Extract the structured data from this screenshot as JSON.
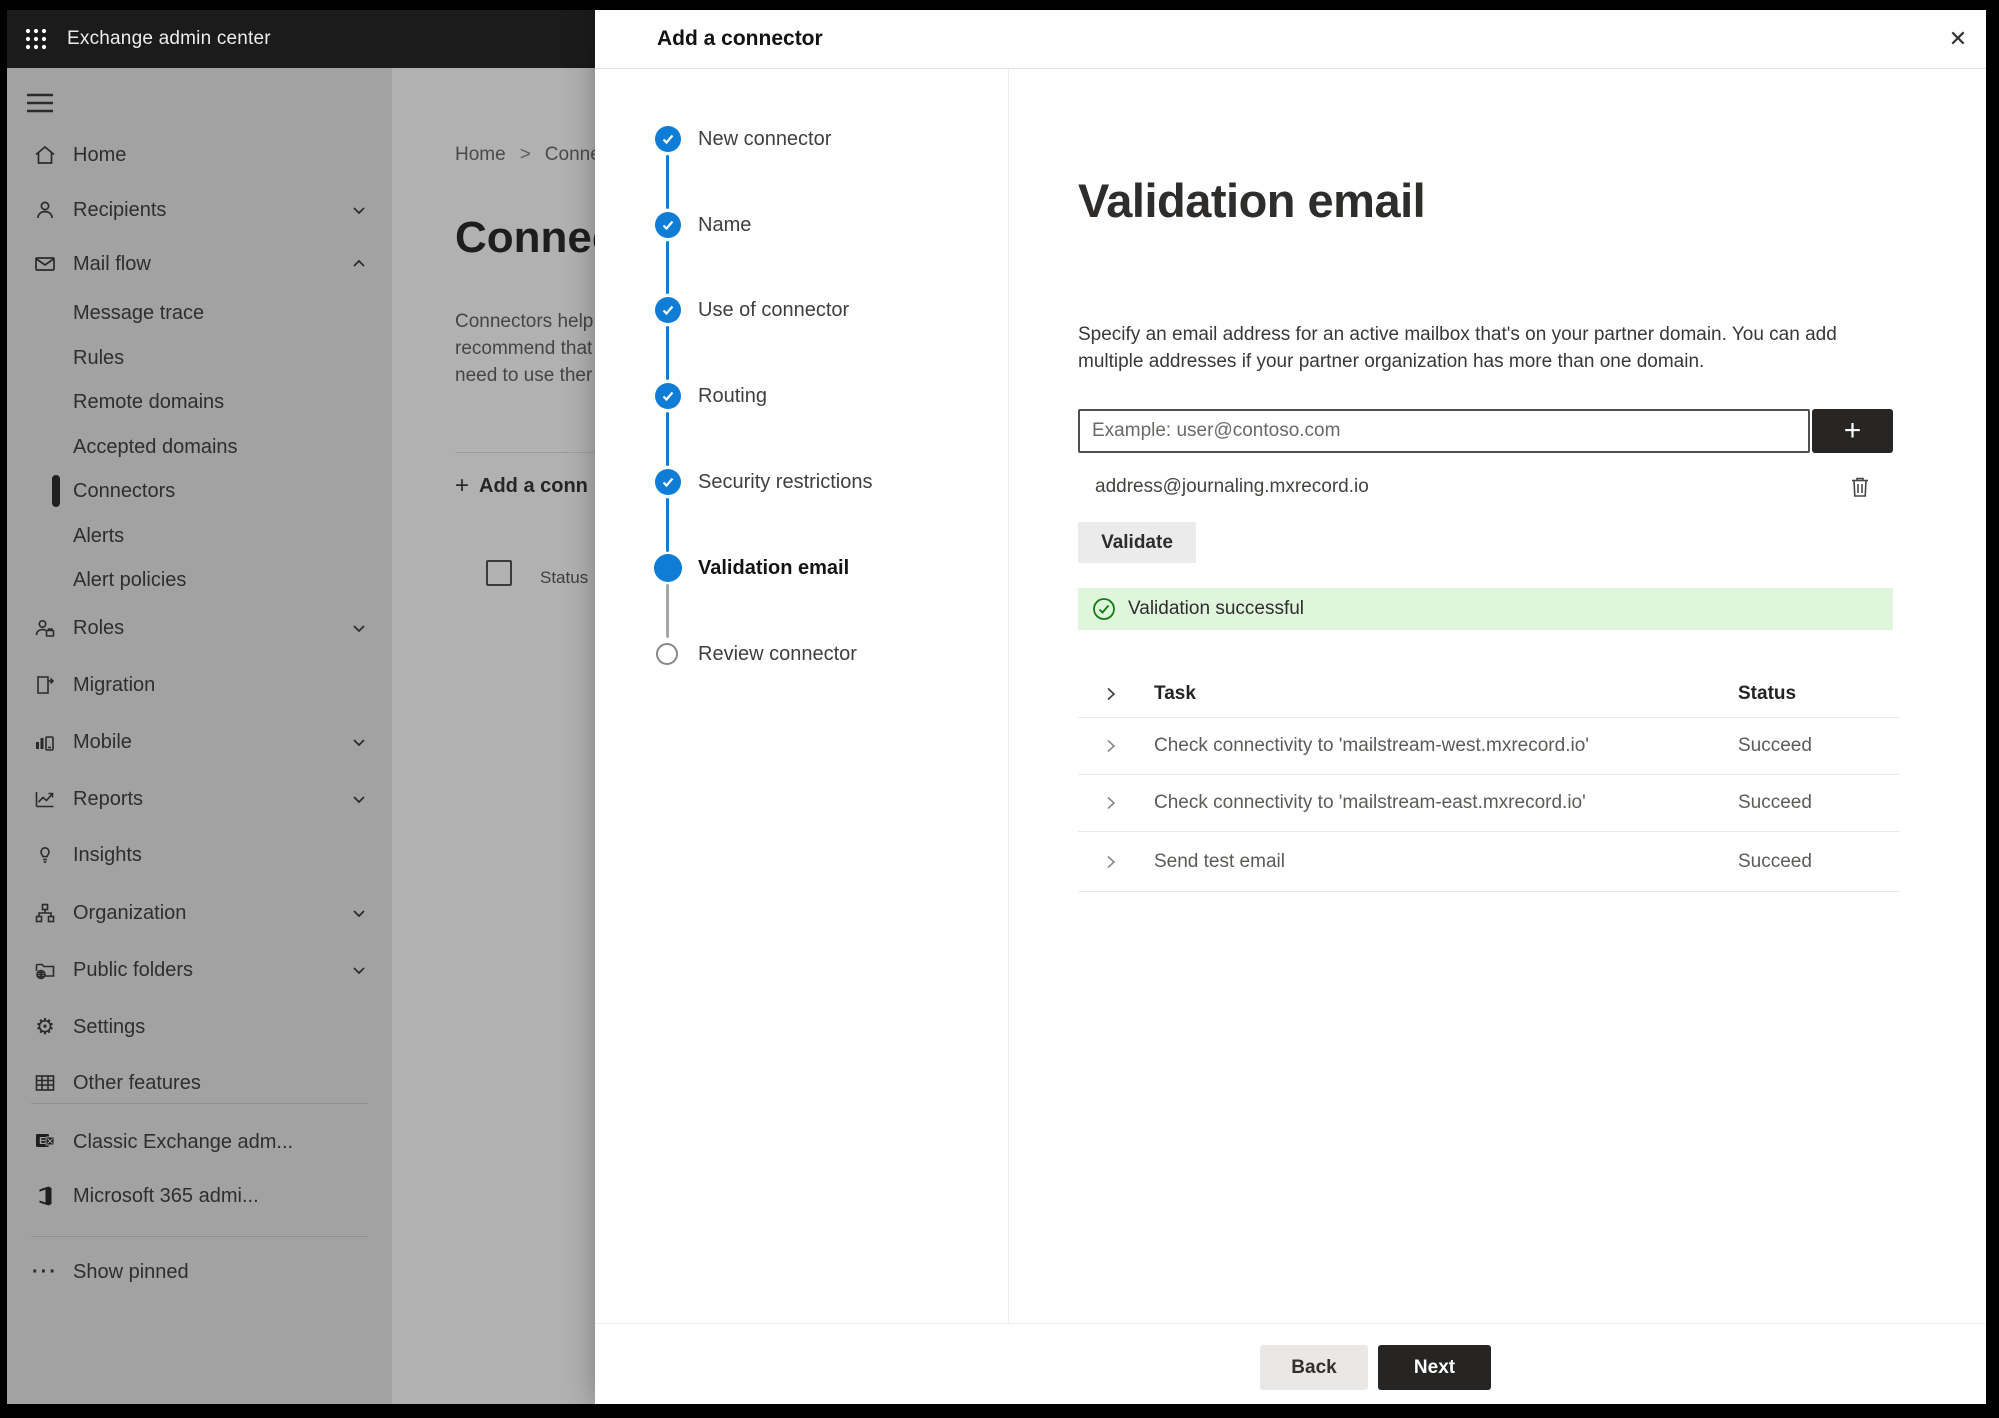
{
  "app": {
    "title": "Exchange admin center"
  },
  "colors": {
    "accent_blue": "#0f7cd6",
    "success_green": "#107c10",
    "banner_green_bg": "#dff6dd",
    "topbar_black": "#1b1b1b",
    "primary_button_dark": "#262524"
  },
  "sidebar": {
    "items": [
      {
        "label": "Home"
      },
      {
        "label": "Recipients"
      },
      {
        "label": "Mail flow"
      },
      {
        "label": "Message trace"
      },
      {
        "label": "Rules"
      },
      {
        "label": "Remote domains"
      },
      {
        "label": "Accepted domains"
      },
      {
        "label": "Connectors"
      },
      {
        "label": "Alerts"
      },
      {
        "label": "Alert policies"
      },
      {
        "label": "Roles"
      },
      {
        "label": "Migration"
      },
      {
        "label": "Mobile"
      },
      {
        "label": "Reports"
      },
      {
        "label": "Insights"
      },
      {
        "label": "Organization"
      },
      {
        "label": "Public folders"
      },
      {
        "label": "Settings"
      },
      {
        "label": "Other features"
      },
      {
        "label": "Classic Exchange adm..."
      },
      {
        "label": "Microsoft 365 admi..."
      },
      {
        "label": "Show pinned"
      }
    ]
  },
  "background": {
    "breadcrumb": {
      "home": "Home",
      "separator": ">",
      "current": "Conne"
    },
    "page_title": "Connec",
    "intro_line1": "Connectors help",
    "intro_line2": "recommend that",
    "intro_line3": "need to use ther",
    "add_connector_label": "Add a conn",
    "add_plus": "+",
    "status_header": "Status"
  },
  "panel": {
    "title": "Add a connector",
    "close_icon": "✕",
    "steps": [
      {
        "label": "New connector",
        "state": "complete"
      },
      {
        "label": "Name",
        "state": "complete"
      },
      {
        "label": "Use of connector",
        "state": "complete"
      },
      {
        "label": "Routing",
        "state": "complete"
      },
      {
        "label": "Security restrictions",
        "state": "complete"
      },
      {
        "label": "Validation email",
        "state": "active"
      },
      {
        "label": "Review connector",
        "state": "upcoming"
      }
    ],
    "content": {
      "title": "Validation email",
      "description_line1": "Specify an email address for an active mailbox that's on your partner domain. You can add",
      "description_line2": "multiple addresses if your partner organization has more than one domain.",
      "email_placeholder": "Example: user@contoso.com",
      "add_address_glyph": "+",
      "address": "address@journaling.mxrecord.io",
      "validate_button": "Validate",
      "banner_text": "Validation successful",
      "table": {
        "task_header": "Task",
        "status_header": "Status",
        "rows": [
          {
            "task": "Check connectivity to 'mailstream-west.mxrecord.io'",
            "status": "Succeed"
          },
          {
            "task": "Check connectivity to 'mailstream-east.mxrecord.io'",
            "status": "Succeed"
          },
          {
            "task": "Send test email",
            "status": "Succeed"
          }
        ]
      },
      "back_button": "Back",
      "next_button": "Next"
    }
  }
}
